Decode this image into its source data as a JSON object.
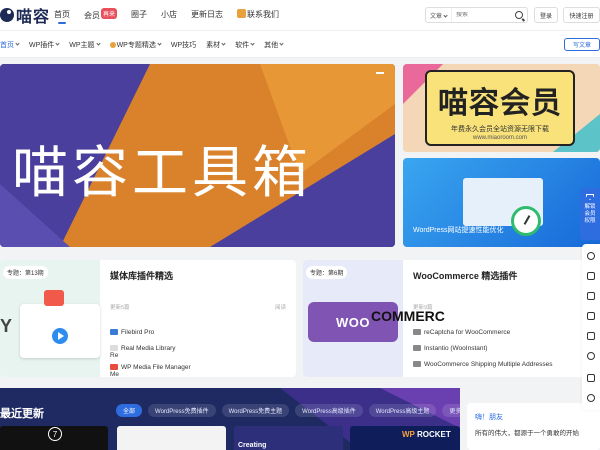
{
  "header": {
    "logo_text": "喵容",
    "nav": [
      {
        "label": "首页",
        "active": true
      },
      {
        "label": "会员",
        "badge": "再来"
      },
      {
        "label": "圈子"
      },
      {
        "label": "小店"
      },
      {
        "label": "更新日志"
      },
      {
        "label": "联系我们"
      }
    ],
    "search": {
      "category": "文章",
      "placeholder": "搜索"
    },
    "login_label": "登录",
    "register_label": "快速注册"
  },
  "subnav": {
    "items": [
      "首页",
      "WP插件",
      "WP主题",
      "WP专题精选",
      "WP技巧",
      "素材",
      "软件",
      "其他"
    ],
    "write_label": "写文章"
  },
  "hero": {
    "title": "喵容工具箱"
  },
  "side_cards": {
    "member": {
      "title": "喵容会员",
      "line1": "年费永久会员全站资源无限下载",
      "line2": "www.miaoroom.com"
    },
    "speed": {
      "caption": "WordPress网站提速性能优化"
    }
  },
  "features": [
    {
      "tag": "专题：第13期",
      "title": "媒体库插件精选",
      "meta_left": "更新5篇",
      "meta_right": "阅读",
      "items": [
        "Filebird Pro",
        "Real Media Library",
        "Re",
        "WP Media File Manager",
        "Me"
      ],
      "big_letter": "Y"
    },
    {
      "tag": "专题：第6期",
      "title": "WooCommerce 精选插件",
      "meta_left": "更新9篇",
      "logo_text": "WOO",
      "logo_ext": "COMMERC",
      "items": [
        "reCaptcha for WooCommerce",
        "Instantio (WooInstant)",
        "WooCommerce Shipping Multiple Addresses"
      ]
    }
  ],
  "latest": {
    "title": "最近更新",
    "pills": [
      "全部",
      "WordPress免费插件",
      "WordPress免费主题",
      "WordPress高级插件",
      "WordPress高级主题",
      "更多 ›"
    ],
    "thumb_num": "7",
    "thumb_creating": "Creating",
    "rocket": {
      "wp": "WP",
      "name": "ROCKET"
    }
  },
  "greet": {
    "hi": "嗨！朋友",
    "text": "所有的伟大，都源于一个勇敢的开始"
  },
  "float": {
    "vip": "解锁会员权限"
  }
}
